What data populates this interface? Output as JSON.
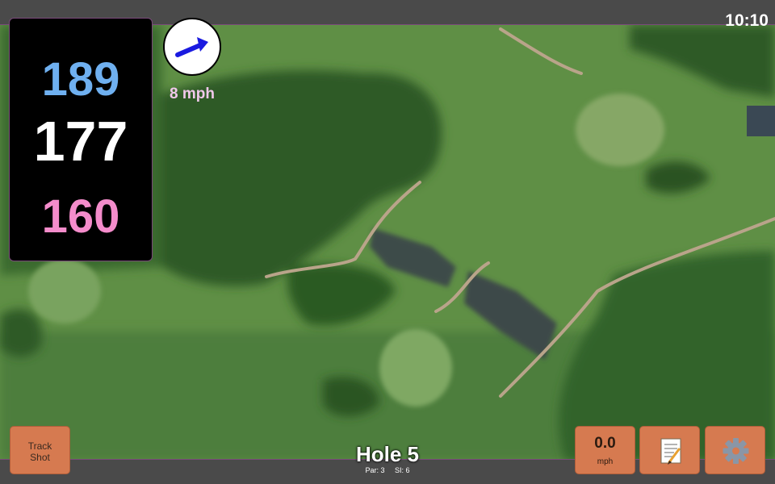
{
  "status": {
    "time": "10:10"
  },
  "distances": {
    "back": "189",
    "middle": "177",
    "front": "160"
  },
  "wind": {
    "speed_label": "8 mph",
    "icon": "wind-arrow-icon"
  },
  "hole": {
    "title": "Hole 5",
    "par": "Par: 3",
    "si": "SI: 6"
  },
  "buttons": {
    "track_line1": "Track",
    "track_line2": "Shot",
    "speed_value": "0.0",
    "speed_unit": "mph",
    "notes_icon": "notepad-icon",
    "settings_icon": "gear-icon"
  },
  "colors": {
    "back": "#6fb0f0",
    "middle": "#ffffff",
    "front": "#f48ccb",
    "button": "#d67a50",
    "bar": "#4a4a4a"
  }
}
